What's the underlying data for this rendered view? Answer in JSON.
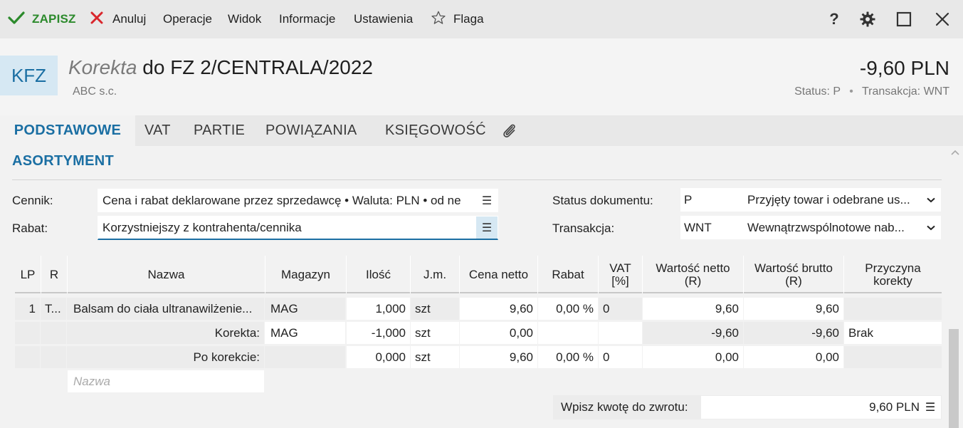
{
  "toolbar": {
    "save_label": "ZAPISZ",
    "cancel_label": "Anuluj",
    "operations_label": "Operacje",
    "view_label": "Widok",
    "info_label": "Informacje",
    "settings_label": "Ustawienia",
    "flag_label": "Flaga",
    "help_label": "?"
  },
  "header": {
    "badge": "KFZ",
    "title_kind": "Korekta",
    "title_rest": "do FZ 2/CENTRALA/2022",
    "subtitle": "ABC s.c.",
    "amount": "-9,60 PLN",
    "status_label": "Status:",
    "status_value": "P",
    "transaction_label": "Transakcja:",
    "transaction_value": "WNT"
  },
  "tabs": [
    {
      "label": "PODSTAWOWE"
    },
    {
      "label": "VAT"
    },
    {
      "label": "PARTIE"
    },
    {
      "label": "POWIĄZANIA"
    },
    {
      "label": "KSIĘGOWOŚĆ"
    }
  ],
  "section": {
    "title": "ASORTYMENT"
  },
  "form": {
    "cennik_label": "Cennik:",
    "cennik_value": "Cena i rabat deklarowane przez sprzedawcę • Waluta: PLN • od ne",
    "rabat_label": "Rabat:",
    "rabat_value": "Korzystniejszy z kontrahenta/cennika",
    "status_label": "Status dokumentu:",
    "status_code": "P",
    "status_desc": "Przyjęty towar i odebrane us...",
    "transakcja_label": "Transakcja:",
    "transakcja_code": "WNT",
    "transakcja_desc": "Wewnątrzwspólnotowe nab..."
  },
  "grid": {
    "headers": {
      "lp": "LP",
      "r": "R",
      "nazwa": "Nazwa",
      "magazyn": "Magazyn",
      "ilosc": "Ilość",
      "jm": "J.m.",
      "cena_netto": "Cena netto",
      "rabat": "Rabat",
      "vat_line1": "VAT",
      "vat_line2": "[%]",
      "wartosc_netto_line1": "Wartość netto",
      "wartosc_netto_line2": "(R)",
      "wartosc_brutto_line1": "Wartość brutto",
      "wartosc_brutto_line2": "(R)",
      "przyczyna_line1": "Przyczyna",
      "przyczyna_line2": "korekty"
    },
    "rows": [
      {
        "lp": "1",
        "r": "T...",
        "nazwa": "Balsam do ciała ultranawilżenie...",
        "magazyn": "MAG",
        "ilosc": "1,000",
        "jm": "szt",
        "cena_netto": "9,60",
        "rabat": "0,00 %",
        "vat": "0",
        "wartosc_netto": "9,60",
        "wartosc_brutto": "9,60",
        "przyczyna": ""
      },
      {
        "lp": "",
        "r": "",
        "nazwa": "Korekta:",
        "magazyn": "MAG",
        "ilosc": "-1,000",
        "jm": "szt",
        "cena_netto": "0,00",
        "rabat": "",
        "vat": "",
        "wartosc_netto": "-9,60",
        "wartosc_brutto": "-9,60",
        "przyczyna": "Brak"
      },
      {
        "lp": "",
        "r": "",
        "nazwa": "Po korekcie:",
        "magazyn": "",
        "ilosc": "0,000",
        "jm": "szt",
        "cena_netto": "9,60",
        "rabat": "0,00 %",
        "vat": "0",
        "wartosc_netto": "0,00",
        "wartosc_brutto": "0,00",
        "przyczyna": ""
      }
    ],
    "name_placeholder": "Nazwa"
  },
  "refund": {
    "label": "Wpisz kwotę do zwrotu:",
    "value": "9,60 PLN"
  },
  "icons": {
    "save": "checkmark-icon",
    "cancel": "x-icon",
    "flag": "star-icon",
    "settings": "gear-icon",
    "maximize": "square-icon",
    "close": "close-icon",
    "attachment": "paperclip-icon",
    "menu": "hamburger-icon",
    "dropdown": "chevron-down-icon"
  },
  "colors": {
    "accent": "#1b6fa3",
    "save_green": "#2c8a2c",
    "cancel_red": "#d9262c"
  }
}
